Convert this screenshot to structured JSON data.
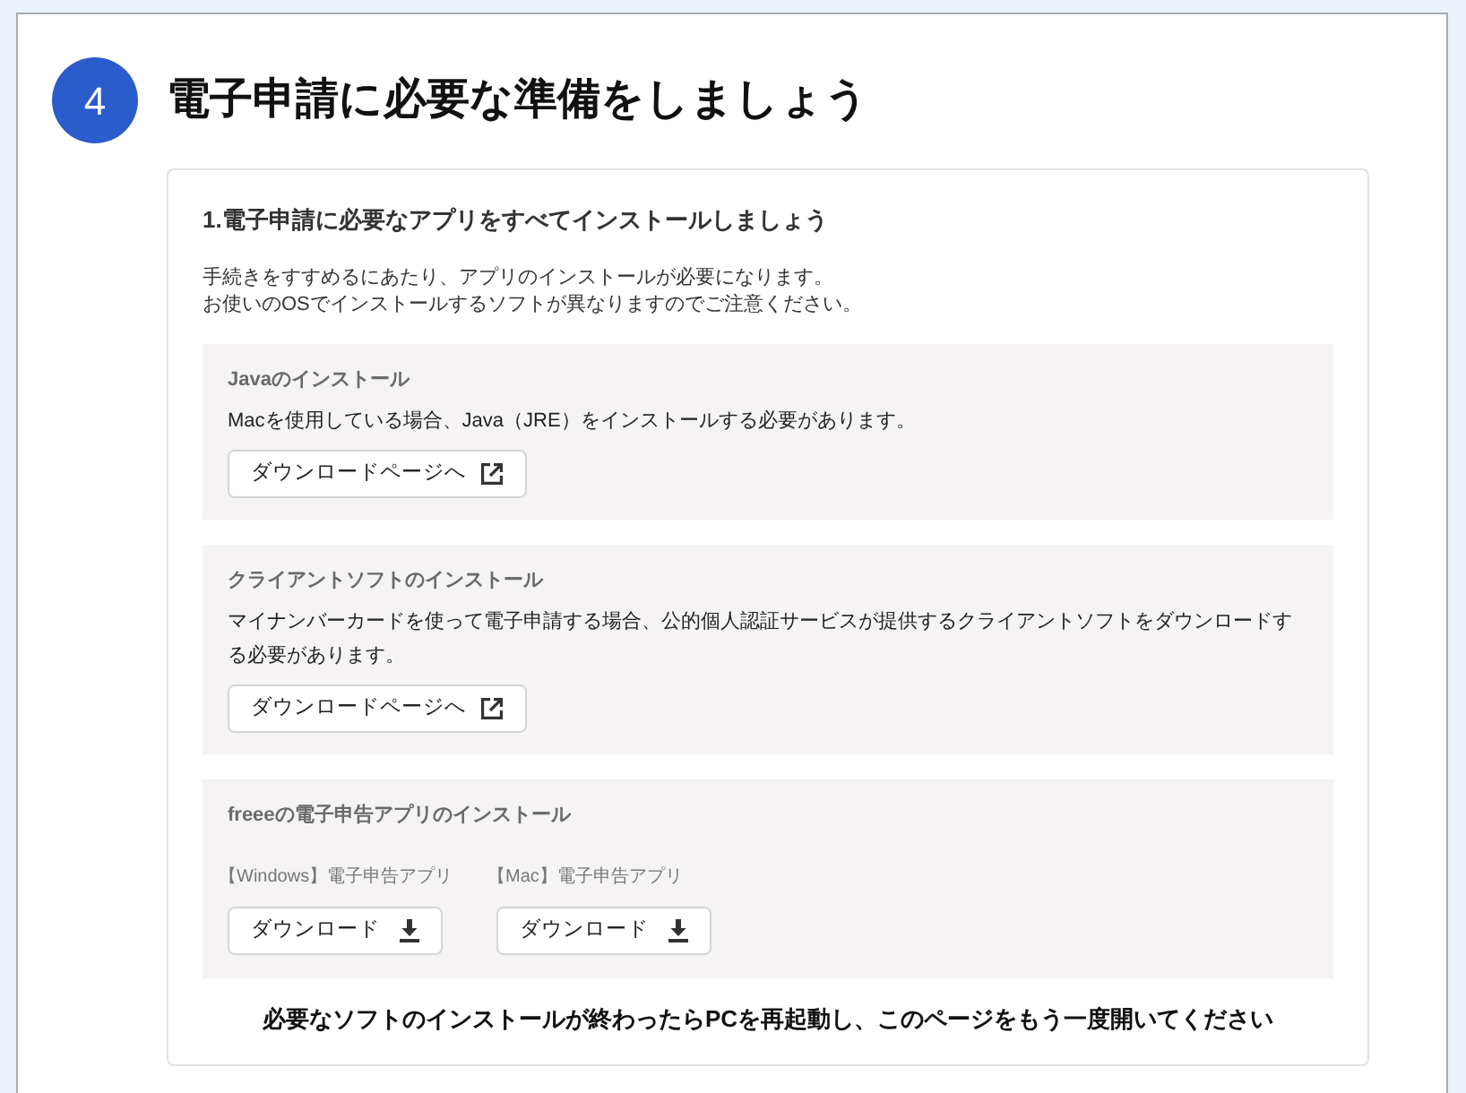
{
  "step": {
    "number": "4",
    "title": "電子申請に必要な準備をしましょう"
  },
  "card": {
    "title": "1.電子申請に必要なアプリをすべてインストールしましょう",
    "description_lines": [
      "手続きをすすめるにあたり、アプリのインストールが必要になります。",
      "お使いのOSでインストールするソフトが異なりますのでご注意ください。"
    ],
    "sections": [
      {
        "kind": "link",
        "title": "Javaのインストール",
        "body": "Macを使用している場合、Java（JRE）をインストールする必要があります。",
        "button": "ダウンロードページへ"
      },
      {
        "kind": "link",
        "title": "クライアントソフトのインストール",
        "body": "マイナンバーカードを使って電子申請する場合、公的個人認証サービスが提供するクライアントソフトをダウンロードする必要があります。",
        "button": "ダウンロードページへ"
      },
      {
        "kind": "downloads",
        "title": "freeeの電子申告アプリのインストール",
        "downloads": [
          {
            "label": "【Windows】電子申告アプリ",
            "button": "ダウンロード"
          },
          {
            "label": "【Mac】電子申告アプリ",
            "button": "ダウンロード"
          }
        ]
      }
    ],
    "note": "必要なソフトのインストールが終わったらPCを再起動し、このページをもう一度開いてください"
  }
}
